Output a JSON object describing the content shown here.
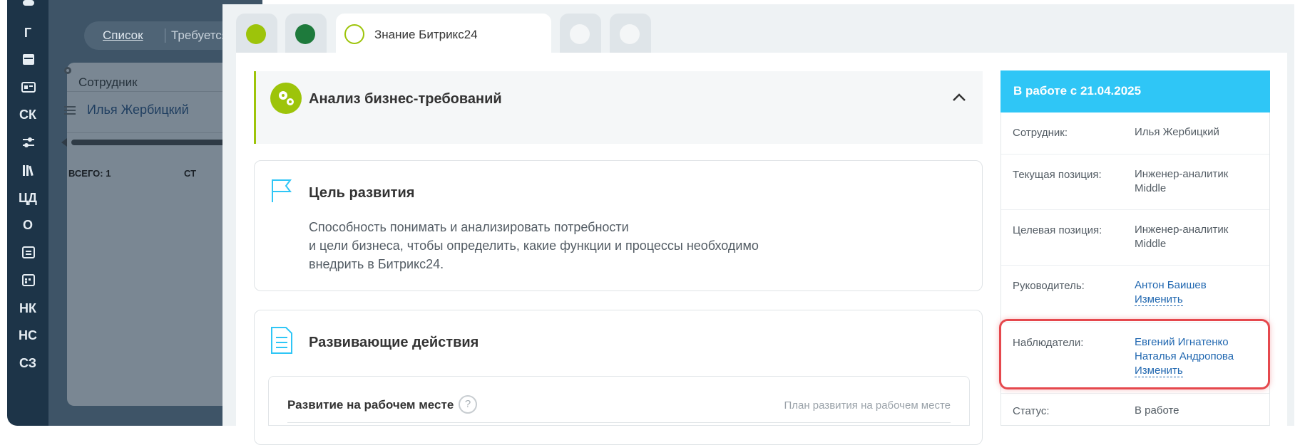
{
  "leftbar": {
    "items": [
      {
        "label": "Г"
      },
      {
        "label": "СК"
      },
      {
        "label": "ЦД"
      },
      {
        "label": "О"
      },
      {
        "label": "НК"
      },
      {
        "label": "НС"
      },
      {
        "label": "СЗ"
      }
    ],
    "icons": [
      "gamepad-icon",
      "calendar-icon",
      "id-card-icon",
      "sliders-icon",
      "library-icon",
      "task-list-icon",
      "calendar-grid-icon"
    ]
  },
  "background": {
    "top_tab_active": "Список",
    "top_tab_next": "Требуется",
    "row_employee_label": "Сотрудник",
    "row_employee_value": "Илья Жербицкий",
    "total": "ВСЕГО: 1",
    "col_start": "СТ"
  },
  "tabs": [
    {
      "icon": "gears-icon"
    },
    {
      "icon": "puzzle-icon"
    },
    {
      "icon": "document-icon",
      "label": "Знание Битрикс24"
    },
    {
      "icon": "list-icon"
    },
    {
      "icon": "book-icon"
    }
  ],
  "section": {
    "title": "Анализ бизнес-требований"
  },
  "goal": {
    "title": "Цель развития",
    "text_line1": "Способность понимать и анализировать потребности",
    "text_line2": "и цели бизнеса, чтобы определить, какие функции и процессы необходимо",
    "text_line3": "внедрить в Битрикс24."
  },
  "actions": {
    "title": "Развивающие действия",
    "sub_label": "Развитие на рабочем месте",
    "sub_help": "?",
    "sub_right": "План развития на рабочем месте"
  },
  "info": {
    "header": "В работе с 21.04.2025",
    "rows": [
      {
        "key": "Сотрудник:",
        "value": "Илья Жербицкий"
      },
      {
        "key": "Текущая позиция:",
        "value_line1": "Инженер-аналитик",
        "value_line2": "Middle"
      },
      {
        "key": "Целевая позиция:",
        "value_line1": "Инженер-аналитик",
        "value_line2": "Middle"
      },
      {
        "key": "Руководитель:",
        "value": "Антон Баишев",
        "action": "Изменить"
      },
      {
        "key": "Наблюдатели:",
        "value_line1": "Евгений Игнатенко",
        "value_line2": "Наталья Андропова",
        "action": "Изменить"
      },
      {
        "key": "Статус:",
        "value": "В работе"
      }
    ]
  },
  "colors": {
    "accent_green": "#9dc40a",
    "dark_green": "#1e7a3c",
    "header_blue": "#2fc6f6",
    "link_blue": "#2067b0",
    "highlight_red": "#e5484d",
    "sidebar_dark": "#1d3448"
  }
}
